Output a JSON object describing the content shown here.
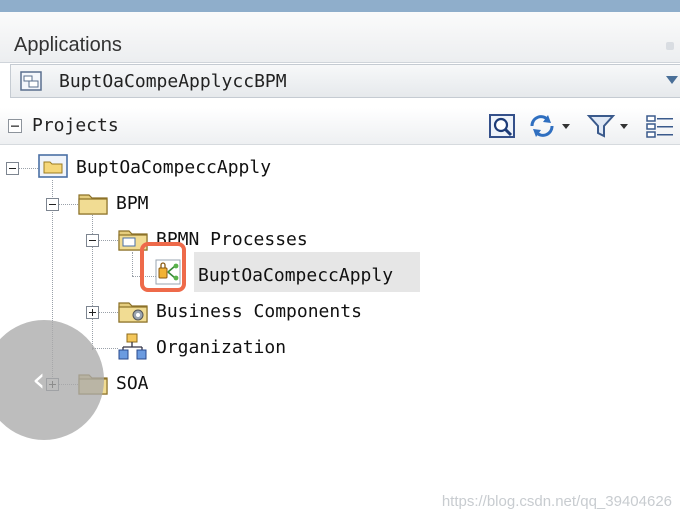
{
  "panel": {
    "title": "Applications"
  },
  "application_selector": {
    "value": "BuptOaCompeApplyccBPM"
  },
  "projects_toolbar": {
    "title": "Projects"
  },
  "tree": {
    "root": "BuptOaCompeccApply",
    "bpm": "BPM",
    "bpmn_processes": "BPMN Processes",
    "process": "BuptOaCompeccApply",
    "business_components": "Business Components",
    "organization": "Organization",
    "soa": "SOA"
  },
  "icons": {
    "app": "application-icon",
    "search": "search-icon",
    "sync": "sync-icon",
    "filter": "filter-icon",
    "options": "options-icon",
    "folder": "folder-icon",
    "process": "bpmn-process-icon",
    "organization": "organization-icon",
    "back": "chevron-left-icon"
  },
  "colors": {
    "highlight": "#ee6a4a",
    "selection": "#e6e6e6",
    "title_bar": "#8faecb"
  },
  "watermark": "https://blog.csdn.net/qq_39404626"
}
